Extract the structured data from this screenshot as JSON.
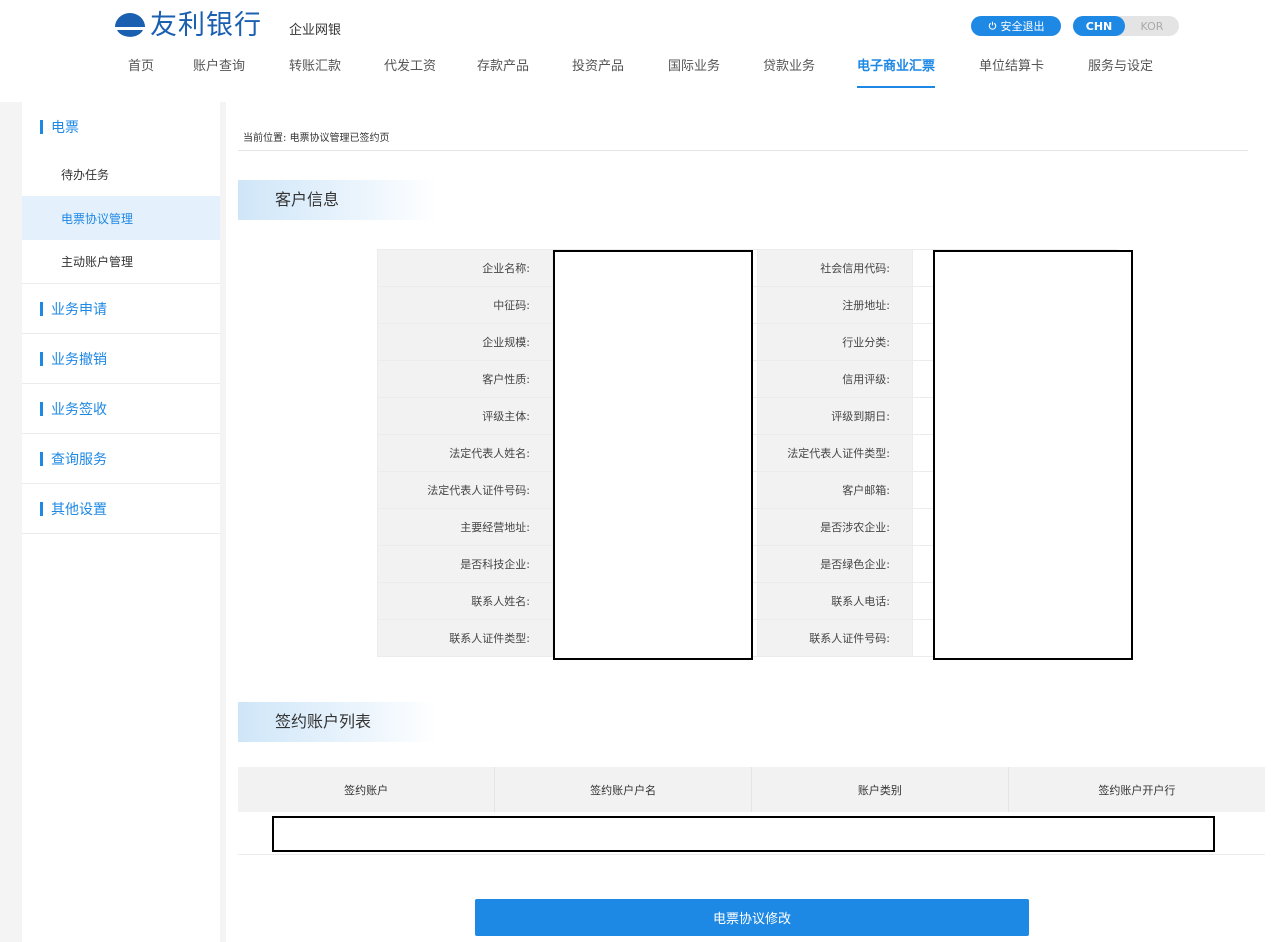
{
  "brand": {
    "name": "友利银行",
    "subtitle": "企业网银",
    "color": "#1b5fb0"
  },
  "top_right": {
    "logout_icon": "power-icon",
    "logout_label": "安全退出",
    "lang_active": "CHN",
    "lang_other": "KOR"
  },
  "nav": {
    "items": [
      "首页",
      "账户查询",
      "转账汇款",
      "代发工资",
      "存款产品",
      "投资产品",
      "国际业务",
      "贷款业务",
      "电子商业汇票",
      "单位结算卡",
      "服务与设定"
    ],
    "active": "电子商业汇票"
  },
  "sidebar": {
    "group_0": "电票",
    "sub_0": "待办任务",
    "sub_1": "电票协议管理",
    "sub_2": "主动账户管理",
    "group_1": "业务申请",
    "group_2": "业务撤销",
    "group_3": "业务签收",
    "group_4": "查询服务",
    "group_5": "其他设置"
  },
  "breadcrumb": {
    "prefix": "当前位置:",
    "path": "电票协议管理已签约页"
  },
  "customer_info": {
    "title": "客户信息",
    "rows": [
      {
        "left": "企业名称:",
        "right": "社会信用代码:"
      },
      {
        "left": "中征码:",
        "right": "注册地址:"
      },
      {
        "left": "企业规模:",
        "right": "行业分类:"
      },
      {
        "left": "客户性质:",
        "right": "信用评级:"
      },
      {
        "left": "评级主体:",
        "right": "评级到期日:"
      },
      {
        "left": "法定代表人姓名:",
        "right": "法定代表人证件类型:"
      },
      {
        "left": "法定代表人证件号码:",
        "right": "客户邮箱:"
      },
      {
        "left": "主要经营地址:",
        "right": "是否涉农企业:"
      },
      {
        "left": "是否科技企业:",
        "right": "是否绿色企业:"
      },
      {
        "left": "联系人姓名:",
        "right": "联系人电话:"
      },
      {
        "left": "联系人证件类型:",
        "right": "联系人证件号码:"
      }
    ]
  },
  "account_list": {
    "title": "签约账户列表",
    "columns": [
      "签约账户",
      "签约账户户名",
      "账户类别",
      "签约账户开户行"
    ]
  },
  "modify_button": "电票协议修改",
  "colors": {
    "accent": "#1e88e5",
    "sidebar_active_bg": "#e4f1fc",
    "label_bg": "#f2f2f2"
  }
}
